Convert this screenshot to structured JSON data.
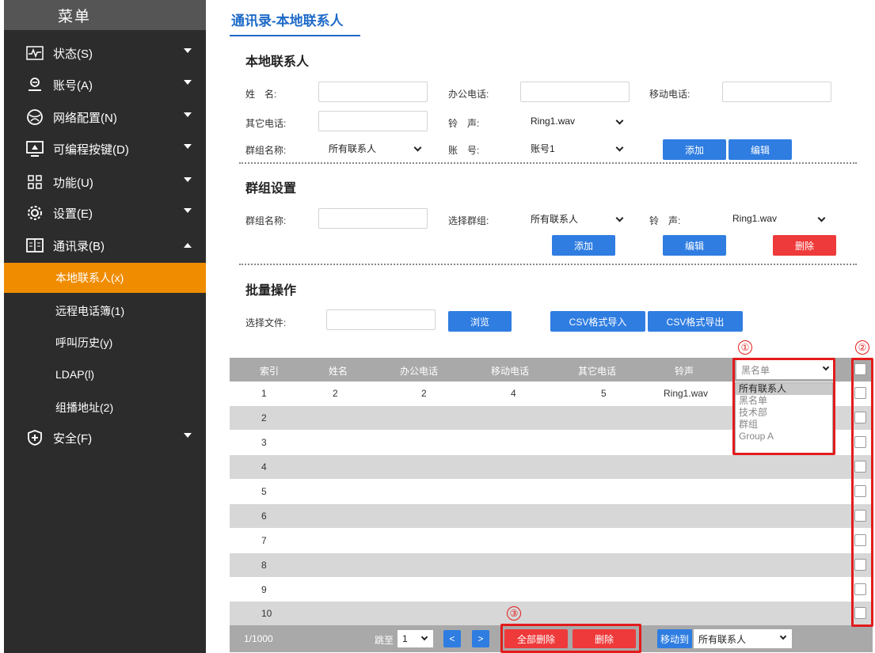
{
  "sidebar": {
    "title": "菜单",
    "items": [
      {
        "label": "状态(S)",
        "icon": "status-monitor-icon"
      },
      {
        "label": "账号(A)",
        "icon": "account-user-icon"
      },
      {
        "label": "网络配置(N)",
        "icon": "network-globe-icon"
      },
      {
        "label": "可编程按键(D)",
        "icon": "programmable-key-icon"
      },
      {
        "label": "功能(U)",
        "icon": "function-grid-icon"
      },
      {
        "label": "设置(E)",
        "icon": "settings-gear-icon"
      },
      {
        "label": "通讯录(B)",
        "icon": "contacts-book-icon"
      },
      {
        "label": "安全(F)",
        "icon": "security-shield-icon"
      }
    ],
    "subitems": [
      "本地联系人(x)",
      "远程电话簿(1)",
      "呼叫历史(y)",
      "LDAP(l)",
      "组播地址(2)"
    ]
  },
  "page": {
    "title": "通讯录-本地联系人"
  },
  "local": {
    "section_title": "本地联系人",
    "name_label": "姓　名:",
    "office_label": "办公电话:",
    "mobile_label": "移动电话:",
    "other_label": "其它电话:",
    "ring_label": "铃　声:",
    "ring_value": "Ring1.wav",
    "group_label": "群组名称:",
    "group_value": "所有联系人",
    "account_label": "账　号:",
    "account_value": "账号1",
    "add_button": "添加",
    "edit_button": "编辑"
  },
  "group": {
    "section_title": "群组设置",
    "name_label": "群组名称:",
    "select_label": "选择群组:",
    "select_value": "所有联系人",
    "ring_label": "铃　声:",
    "ring_value": "Ring1.wav",
    "add_button": "添加",
    "edit_button": "编辑",
    "delete_button": "删除"
  },
  "batch": {
    "section_title": "批量操作",
    "file_label": "选择文件:",
    "browse_button": "浏览",
    "import_button": "CSV格式导入",
    "export_button": "CSV格式导出"
  },
  "table": {
    "headers": [
      "索引",
      "姓名",
      "办公电话",
      "移动电话",
      "其它电话",
      "铃声"
    ],
    "filter_value": "黑名单",
    "filter_options": [
      "所有联系人",
      "黑名单",
      "技术部",
      "群组",
      "Group A"
    ],
    "rows": [
      {
        "index": "1",
        "name": "2",
        "office": "2",
        "mobile": "4",
        "other": "5",
        "ring": "Ring1.wav"
      },
      {
        "index": "2"
      },
      {
        "index": "3"
      },
      {
        "index": "4"
      },
      {
        "index": "5"
      },
      {
        "index": "6"
      },
      {
        "index": "7"
      },
      {
        "index": "8"
      },
      {
        "index": "9"
      },
      {
        "index": "10"
      }
    ]
  },
  "footer": {
    "page_count": "1/1000",
    "jump_label": "跳至",
    "jump_value": "1",
    "prev_button": "<",
    "next_button": ">",
    "delete_all_button": "全部删除",
    "delete_button": "删除",
    "move_button": "移动到",
    "move_value": "所有联系人"
  },
  "annotations": {
    "one": "①",
    "two": "②",
    "three": "③"
  },
  "colors": {
    "accent": "#2f7de1",
    "active_menu": "#f08c00",
    "danger": "#ee3a3a",
    "annotation": "#e31b1b"
  }
}
